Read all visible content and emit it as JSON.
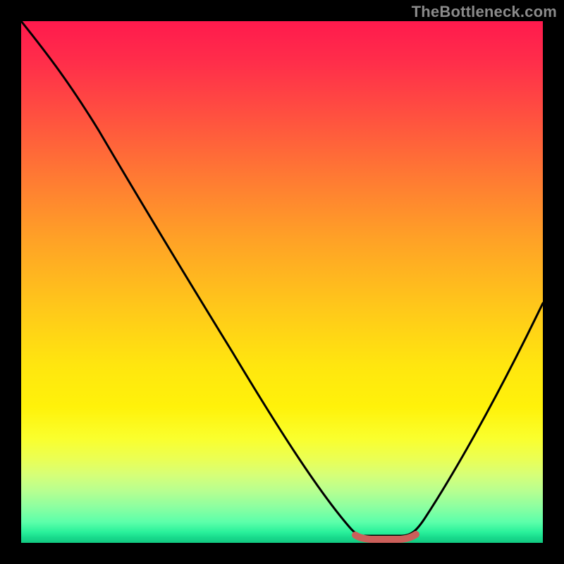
{
  "watermark": {
    "text": "TheBottleneck.com"
  },
  "chart_data": {
    "type": "line",
    "title": "",
    "xlabel": "",
    "ylabel": "",
    "xlim": [
      0,
      100
    ],
    "ylim": [
      0,
      100
    ],
    "x": [
      0,
      5,
      10,
      15,
      20,
      25,
      30,
      35,
      40,
      45,
      50,
      55,
      60,
      63,
      65,
      68,
      70,
      73,
      77,
      82,
      88,
      94,
      100
    ],
    "values": [
      100,
      97,
      92,
      85,
      78,
      69,
      60,
      51,
      42,
      33,
      24,
      16,
      8,
      3,
      1,
      0,
      0,
      0,
      3,
      10,
      22,
      36,
      52
    ],
    "flat_segment": {
      "x_start": 64,
      "x_end": 74,
      "y": 0
    },
    "background_gradient": {
      "direction": "vertical",
      "stops": [
        {
          "pos": 0,
          "color": "#ff1a4d"
        },
        {
          "pos": 50,
          "color": "#ffc81a"
        },
        {
          "pos": 80,
          "color": "#f5ff40"
        },
        {
          "pos": 100,
          "color": "#12c880"
        }
      ]
    }
  }
}
